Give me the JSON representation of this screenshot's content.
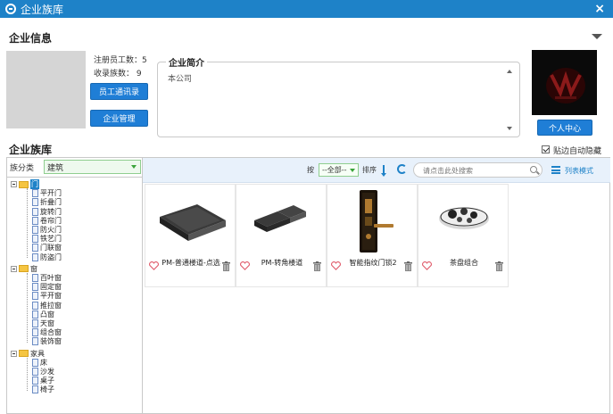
{
  "window": {
    "title": "企业族库",
    "close_label": "×"
  },
  "company_info": {
    "section_title": "企业信息",
    "registered_staff": "注册员工数：5",
    "collected_families": "收录族数：  9",
    "staff_directory_button": "员工通讯录",
    "company_manage_button": "企业管理",
    "intro_title": "企业简介",
    "intro_text": "本公司",
    "personal_center_button": "个人中心"
  },
  "library": {
    "section_title": "企业族库",
    "auto_hide_label": "贴边自动隐藏",
    "auto_hide_checked": true,
    "category_label": "族分类",
    "category_value": "建筑",
    "tree": [
      {
        "label": "门",
        "level": 0,
        "selected": true,
        "children": [
          "平开门",
          "折叠门",
          "旋转门",
          "卷帘门",
          "防火门",
          "铁艺门",
          "门联窗",
          "防盗门"
        ]
      },
      {
        "label": "窗",
        "level": 0,
        "selected": false,
        "children": [
          "百叶窗",
          "固定窗",
          "平开窗",
          "推拉窗",
          "凸窗",
          "天窗",
          "组合窗",
          "装饰窗"
        ]
      },
      {
        "label": "家具",
        "level": 0,
        "selected": false,
        "children": [
          "床",
          "沙发",
          "桌子",
          "椅子"
        ]
      }
    ]
  },
  "toolbar": {
    "by_label": "按",
    "filter_value": "--全部--",
    "sort_label": "排序",
    "search_placeholder": "请点击此处搜索",
    "list_mode_label": "列表模式"
  },
  "items": [
    {
      "name": "PM-普通楼道-点选",
      "icon": "floor-slab-icon"
    },
    {
      "name": "PM-转角楼道",
      "icon": "corner-slab-icon"
    },
    {
      "name": "智能指纹门锁2",
      "icon": "door-lock-icon"
    },
    {
      "name": "茶盘组合",
      "icon": "tea-tray-icon"
    }
  ],
  "colors": {
    "title_bar": "#1e82c8",
    "button_blue": "#1f7ed6",
    "toolbar_bg": "#e8f1fb"
  }
}
